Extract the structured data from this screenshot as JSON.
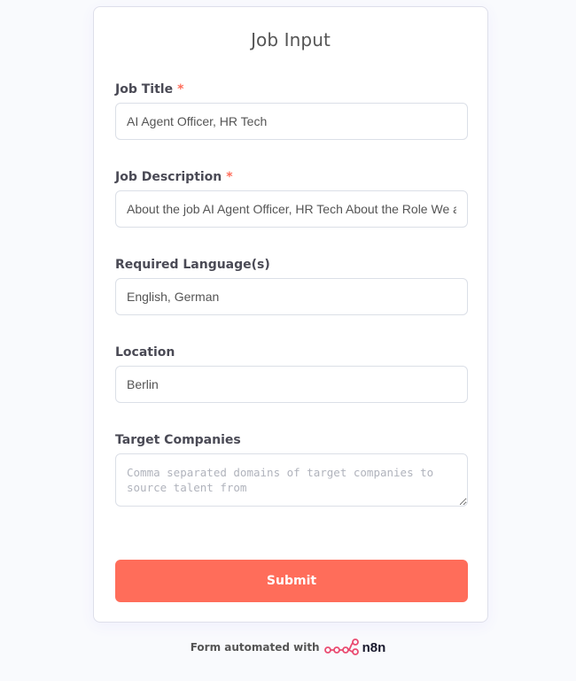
{
  "form": {
    "title": "Job Input",
    "submit_label": "Submit"
  },
  "fields": [
    {
      "label": "Job Title",
      "required_mark": "*",
      "value": "AI Agent Officer, HR Tech"
    },
    {
      "label": "Job Description",
      "required_mark": "*",
      "value": "About the job AI Agent Officer, HR Tech About the Role We are looking for"
    },
    {
      "label": "Required Language(s)",
      "value": "English, German"
    },
    {
      "label": "Location",
      "value": "Berlin"
    },
    {
      "label": "Target Companies",
      "value": "",
      "placeholder": "Comma separated domains of target companies to source talent from"
    }
  ],
  "footer": {
    "text": "Form automated with",
    "brand": "n8n",
    "logo_icon": "n8n-logo-icon",
    "brand_color": "#ea4b71"
  },
  "colors": {
    "accent": "#ff6d5a",
    "page_bg": "#f9fafd"
  }
}
